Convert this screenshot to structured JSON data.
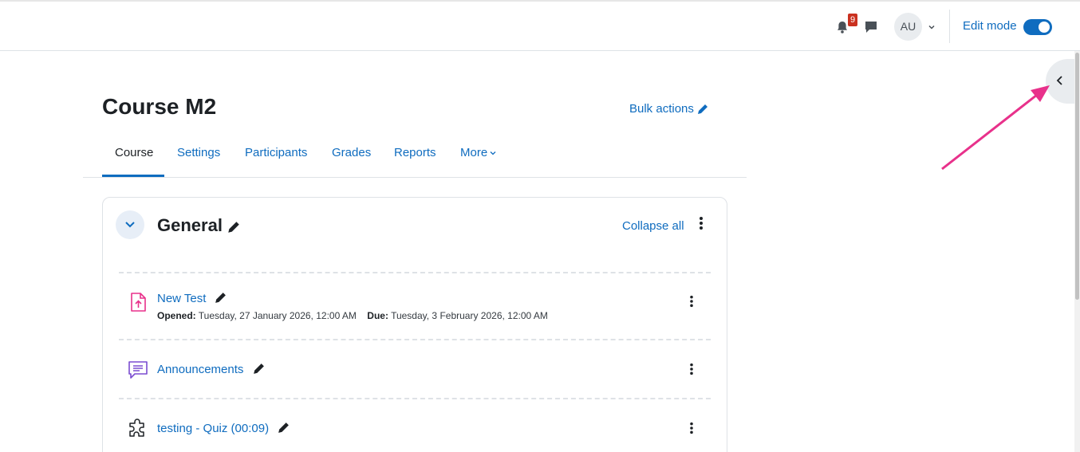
{
  "navbar": {
    "notification_count": "9",
    "avatar_initials": "AU",
    "edit_mode_label": "Edit mode",
    "edit_mode_on": true
  },
  "course": {
    "title": "Course M2",
    "bulk_actions_label": "Bulk actions"
  },
  "tabs": [
    {
      "label": "Course",
      "active": true
    },
    {
      "label": "Settings",
      "active": false
    },
    {
      "label": "Participants",
      "active": false
    },
    {
      "label": "Grades",
      "active": false
    },
    {
      "label": "Reports",
      "active": false
    },
    {
      "label": "More",
      "active": false
    }
  ],
  "section": {
    "title": "General",
    "collapse_all_label": "Collapse all",
    "activities": [
      {
        "icon": "assignment-upload-icon",
        "name": "New Test",
        "opened_label": "Opened:",
        "opened_value": "Tuesday, 27 January 2026, 12:00 AM",
        "due_label": "Due:",
        "due_value": "Tuesday, 3 February 2026, 12:00 AM"
      },
      {
        "icon": "forum-icon",
        "name": "Announcements"
      },
      {
        "icon": "quiz-puzzle-icon",
        "name": "testing - Quiz (00:09)"
      }
    ]
  },
  "colors": {
    "brand_blue": "#0f6cbf",
    "assignment_pink": "#e8318b",
    "forum_purple": "#7b4dd0",
    "annotation_arrow": "#e8318b",
    "badge_red": "#ca3120"
  }
}
